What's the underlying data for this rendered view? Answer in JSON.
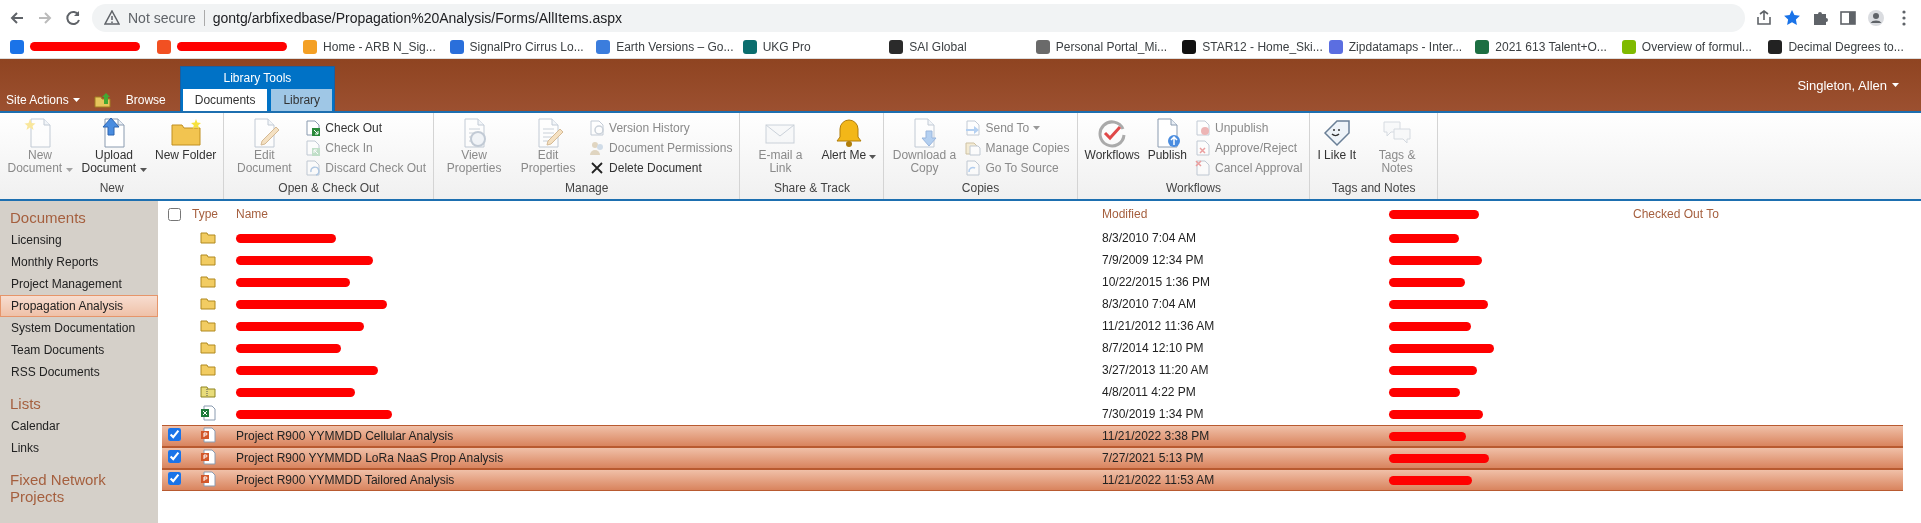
{
  "browser": {
    "security_label": "Not secure",
    "url": "gontg/arbfixedbase/Propagation%20Analysis/Forms/AllItems.aspx",
    "bookmarks": [
      {
        "redacted": true,
        "color": "#1a73e8"
      },
      {
        "redacted": true,
        "color": "#f25022"
      },
      {
        "label": "Home - ARB N_Sig...",
        "redacted": false,
        "color": "#f4a025"
      },
      {
        "label": "SignalPro Cirrus Lo...",
        "redacted": false,
        "color": "#2a6fdb"
      },
      {
        "label": "Earth Versions – Go...",
        "redacted": false,
        "color": "#3b7ddd"
      },
      {
        "label": "UKG Pro",
        "redacted": false,
        "color": "#0b6e6e"
      },
      {
        "label": "SAI Global",
        "redacted": false,
        "color": "#2b2b2b"
      },
      {
        "label": "Personal Portal_Mi...",
        "redacted": false,
        "color": "#6a6a6a"
      },
      {
        "label": "STAR12 - Home_Ski...",
        "redacted": false,
        "color": "#111111"
      },
      {
        "label": "Zipdatamaps - Inter...",
        "redacted": false,
        "color": "#5b6ee1"
      },
      {
        "label": "2021 613 Talent+O...",
        "redacted": false,
        "color": "#1d6f42"
      },
      {
        "label": "Overview of formul...",
        "redacted": false,
        "color": "#7fba00"
      },
      {
        "label": "Decimal Degrees to...",
        "redacted": false,
        "color": "#222222"
      }
    ]
  },
  "header": {
    "site_actions": "Site Actions",
    "browse": "Browse",
    "tool_group": "Library Tools",
    "tabs": [
      {
        "label": "Documents",
        "selected": true
      },
      {
        "label": "Library",
        "selected": false
      }
    ],
    "user": "Singleton, Allen"
  },
  "ribbon": {
    "groups": [
      {
        "label": "New",
        "buttons": [
          {
            "kind": "large",
            "label": "New Document",
            "dropdown": true,
            "disabled": true
          },
          {
            "kind": "large",
            "label": "Upload Document",
            "dropdown": true,
            "disabled": false
          },
          {
            "kind": "large",
            "label": "New Folder",
            "dropdown": false,
            "disabled": false
          }
        ]
      },
      {
        "label": "Open & Check Out",
        "buttons": [
          {
            "kind": "large",
            "label": "Edit Document",
            "dropdown": false,
            "disabled": true
          },
          {
            "kind": "small",
            "label": "Check Out",
            "dropdown": false,
            "disabled": false
          },
          {
            "kind": "small",
            "label": "Check In",
            "dropdown": false,
            "disabled": true
          },
          {
            "kind": "small",
            "label": "Discard Check Out",
            "dropdown": false,
            "disabled": true
          }
        ]
      },
      {
        "label": "Manage",
        "buttons": [
          {
            "kind": "large",
            "label": "View Properties",
            "dropdown": false,
            "disabled": true
          },
          {
            "kind": "large",
            "label": "Edit Properties",
            "dropdown": false,
            "disabled": true
          },
          {
            "kind": "small",
            "label": "Version History",
            "dropdown": false,
            "disabled": true
          },
          {
            "kind": "small",
            "label": "Document Permissions",
            "dropdown": false,
            "disabled": true
          },
          {
            "kind": "small",
            "label": "Delete Document",
            "dropdown": false,
            "disabled": false
          }
        ]
      },
      {
        "label": "Share & Track",
        "buttons": [
          {
            "kind": "large",
            "label": "E-mail a Link",
            "dropdown": false,
            "disabled": true
          },
          {
            "kind": "large",
            "label": "Alert Me",
            "dropdown": true,
            "disabled": false
          }
        ]
      },
      {
        "label": "Copies",
        "buttons": [
          {
            "kind": "large",
            "label": "Download a Copy",
            "dropdown": false,
            "disabled": true
          },
          {
            "kind": "small",
            "label": "Send To",
            "dropdown": true,
            "disabled": true
          },
          {
            "kind": "small",
            "label": "Manage Copies",
            "dropdown": false,
            "disabled": true
          },
          {
            "kind": "small",
            "label": "Go To Source",
            "dropdown": false,
            "disabled": true
          }
        ]
      },
      {
        "label": "Workflows",
        "buttons": [
          {
            "kind": "large",
            "label": "Workflows",
            "dropdown": false,
            "disabled": false
          },
          {
            "kind": "large",
            "label": "Publish",
            "dropdown": false,
            "disabled": false
          },
          {
            "kind": "small",
            "label": "Unpublish",
            "dropdown": false,
            "disabled": true
          },
          {
            "kind": "small",
            "label": "Approve/Reject",
            "dropdown": false,
            "disabled": true
          },
          {
            "kind": "small",
            "label": "Cancel Approval",
            "dropdown": false,
            "disabled": true
          }
        ]
      },
      {
        "label": "Tags and Notes",
        "buttons": [
          {
            "kind": "large",
            "label": "I Like It",
            "dropdown": false,
            "disabled": false
          },
          {
            "kind": "large",
            "label": "Tags & Notes",
            "dropdown": false,
            "disabled": true
          }
        ]
      }
    ]
  },
  "sidebar": {
    "sections": [
      {
        "heading": "Documents",
        "items": [
          {
            "label": "Licensing",
            "selected": false
          },
          {
            "label": "Monthly Reports",
            "selected": false
          },
          {
            "label": "Project Management",
            "selected": false
          },
          {
            "label": "Propagation Analysis",
            "selected": true
          },
          {
            "label": "System Documentation",
            "selected": false
          },
          {
            "label": "Team Documents",
            "selected": false
          },
          {
            "label": "RSS Documents",
            "selected": false
          }
        ]
      },
      {
        "heading": "Lists",
        "items": [
          {
            "label": "Calendar",
            "selected": false
          },
          {
            "label": "Links",
            "selected": false
          }
        ]
      },
      {
        "heading": "Fixed Network Projects"
      }
    ]
  },
  "table": {
    "select_all": false,
    "columns": [
      {
        "label": "Type",
        "redacted": false
      },
      {
        "label": "Name",
        "redacted": false
      },
      {
        "label": "Modified",
        "redacted": false
      },
      {
        "redacted": true
      },
      {
        "label": "Checked Out To",
        "redacted": false
      }
    ],
    "rows": [
      {
        "kind": "folder",
        "name_redacted": true,
        "modified": "8/3/2010 7:04 AM",
        "selected": false
      },
      {
        "kind": "folder",
        "name_redacted": true,
        "modified": "7/9/2009 12:34 PM",
        "selected": false
      },
      {
        "kind": "folder",
        "name_redacted": true,
        "modified": "10/22/2015 1:36 PM",
        "selected": false
      },
      {
        "kind": "folder",
        "name_redacted": true,
        "modified": "8/3/2010 7:04 AM",
        "selected": false
      },
      {
        "kind": "folder",
        "name_redacted": true,
        "modified": "11/21/2012 11:36 AM",
        "selected": false
      },
      {
        "kind": "folder",
        "name_redacted": true,
        "modified": "8/7/2014 12:10 PM",
        "selected": false
      },
      {
        "kind": "folder",
        "name_redacted": true,
        "modified": "3/27/2013 11:20 AM",
        "selected": false
      },
      {
        "kind": "zip",
        "name_redacted": true,
        "modified": "4/8/2011 4:22 PM",
        "selected": false
      },
      {
        "kind": "spreadsheet",
        "name_redacted": true,
        "modified": "7/30/2019 1:34 PM",
        "selected": false
      },
      {
        "kind": "presentation",
        "name_redacted": false,
        "name": "Project R900 YYMMDD Cellular Analysis",
        "modified": "11/21/2022 3:38 PM",
        "selected": true
      },
      {
        "kind": "presentation",
        "name_redacted": false,
        "name": "Project R900 YYMMDD LoRa NaaS Prop Analysis",
        "modified": "7/27/2021 5:13 PM",
        "selected": true
      },
      {
        "kind": "presentation",
        "name_redacted": false,
        "name": "Project R900 YYMMDD Tailored Analysis",
        "modified": "11/21/2022 11:53 AM",
        "selected": true
      }
    ]
  }
}
